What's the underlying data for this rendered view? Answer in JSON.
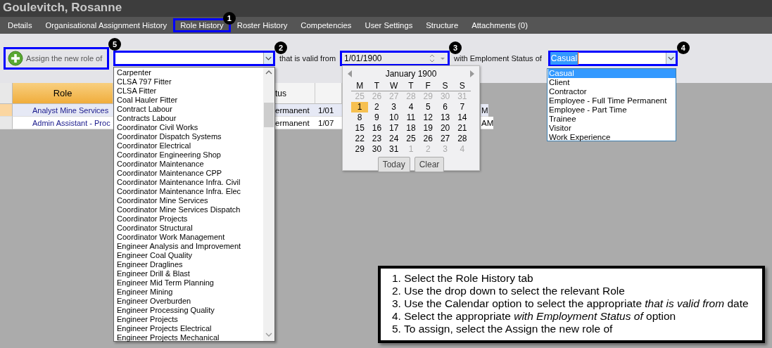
{
  "window": {
    "title": "Goulevitch, Rosanne"
  },
  "tabs": [
    {
      "label": "Details",
      "selected": false
    },
    {
      "label": "Organisational Assignment History",
      "selected": false
    },
    {
      "label": "Role History",
      "selected": true,
      "badge": "1"
    },
    {
      "label": "Roster History",
      "selected": false
    },
    {
      "label": "Competencies",
      "selected": false
    },
    {
      "label": "User Settings",
      "selected": false
    },
    {
      "label": "Structure",
      "selected": false
    },
    {
      "label": "Attachments (0)",
      "selected": false
    }
  ],
  "toolbar": {
    "assign_button": {
      "label": "Assign the new role of",
      "badge": "5"
    },
    "role_field": {
      "badge": "2"
    },
    "valid_from_label": "that is valid from",
    "date_field": {
      "value": "1/01/1900",
      "badge": "3"
    },
    "status_label": "with Emploment Status of",
    "status_field": {
      "value": "Casual",
      "badge": "4"
    }
  },
  "grid": {
    "columns": [
      "Role",
      "tus"
    ],
    "rows": [
      {
        "role": "Analyst Mine Services",
        "status": "ermanent",
        "date": "1/01",
        "time": "M",
        "selected": true
      },
      {
        "role": "Admin Assistant - Proc",
        "status": "ermanent",
        "date": "1/07",
        "time": "AM",
        "selected": false
      }
    ]
  },
  "role_dropdown": {
    "items": [
      "Carpenter",
      "CLSA 797 Fitter",
      "CLSA Fitter",
      "Coal Hauler Fitter",
      "Contract Labour",
      "Contracts Labour",
      "Coordinator Civil Works",
      "Coordinator Dispatch Systems",
      "Coordinator Electrical",
      "Coordinator Engineering Shop",
      "Coordinator Maintenance",
      "Coordinator Maintenance CPP",
      "Coordinator Maintenance Infra. Civil",
      "Coordinator Maintenance Infra. Elec",
      "Coordinator Mine Services",
      "Coordinator Mine Services Dispatch",
      "Coordinator Projects",
      "Coordinator Structural",
      "Coordinator Work Management",
      "Engineer Analysis and Improvement",
      "Engineer Coal Quality",
      "Engineer Draglines",
      "Engineer Drill & Blast",
      "Engineer Mid Term Planning",
      "Engineer Mining",
      "Engineer Overburden",
      "Engineer Processing Quality",
      "Engineer Projects",
      "Engineer Projects Electrical",
      "Engineer Projects Mechanical"
    ]
  },
  "calendar": {
    "title": "January 1900",
    "weekdays": [
      "M",
      "T",
      "W",
      "T",
      "F",
      "S",
      "S"
    ],
    "days": [
      {
        "label": "25",
        "muted": true,
        "selected": false
      },
      {
        "label": "26",
        "muted": true,
        "selected": false
      },
      {
        "label": "27",
        "muted": true,
        "selected": false
      },
      {
        "label": "28",
        "muted": true,
        "selected": false
      },
      {
        "label": "29",
        "muted": true,
        "selected": false
      },
      {
        "label": "30",
        "muted": true,
        "selected": false
      },
      {
        "label": "31",
        "muted": true,
        "selected": false
      },
      {
        "label": "1",
        "muted": false,
        "selected": true
      },
      {
        "label": "2",
        "muted": false,
        "selected": false
      },
      {
        "label": "3",
        "muted": false,
        "selected": false
      },
      {
        "label": "4",
        "muted": false,
        "selected": false
      },
      {
        "label": "5",
        "muted": false,
        "selected": false
      },
      {
        "label": "6",
        "muted": false,
        "selected": false
      },
      {
        "label": "7",
        "muted": false,
        "selected": false
      },
      {
        "label": "8",
        "muted": false,
        "selected": false
      },
      {
        "label": "9",
        "muted": false,
        "selected": false
      },
      {
        "label": "10",
        "muted": false,
        "selected": false
      },
      {
        "label": "11",
        "muted": false,
        "selected": false
      },
      {
        "label": "12",
        "muted": false,
        "selected": false
      },
      {
        "label": "13",
        "muted": false,
        "selected": false
      },
      {
        "label": "14",
        "muted": false,
        "selected": false
      },
      {
        "label": "15",
        "muted": false,
        "selected": false
      },
      {
        "label": "16",
        "muted": false,
        "selected": false
      },
      {
        "label": "17",
        "muted": false,
        "selected": false
      },
      {
        "label": "18",
        "muted": false,
        "selected": false
      },
      {
        "label": "19",
        "muted": false,
        "selected": false
      },
      {
        "label": "20",
        "muted": false,
        "selected": false
      },
      {
        "label": "21",
        "muted": false,
        "selected": false
      },
      {
        "label": "22",
        "muted": false,
        "selected": false
      },
      {
        "label": "23",
        "muted": false,
        "selected": false
      },
      {
        "label": "24",
        "muted": false,
        "selected": false
      },
      {
        "label": "25",
        "muted": false,
        "selected": false
      },
      {
        "label": "26",
        "muted": false,
        "selected": false
      },
      {
        "label": "27",
        "muted": false,
        "selected": false
      },
      {
        "label": "28",
        "muted": false,
        "selected": false
      },
      {
        "label": "29",
        "muted": false,
        "selected": false
      },
      {
        "label": "30",
        "muted": false,
        "selected": false
      },
      {
        "label": "31",
        "muted": false,
        "selected": false
      },
      {
        "label": "1",
        "muted": true,
        "selected": false
      },
      {
        "label": "2",
        "muted": true,
        "selected": false
      },
      {
        "label": "3",
        "muted": true,
        "selected": false
      },
      {
        "label": "4",
        "muted": true,
        "selected": false
      }
    ],
    "buttons": [
      "Today",
      "Clear"
    ]
  },
  "status_dropdown": {
    "items": [
      {
        "label": "Casual",
        "selected": true
      },
      {
        "label": "Client",
        "selected": false
      },
      {
        "label": "Contractor",
        "selected": false
      },
      {
        "label": "Employee - Full Time Permanent",
        "selected": false
      },
      {
        "label": "Employee - Part Time",
        "selected": false
      },
      {
        "label": "Trainee",
        "selected": false
      },
      {
        "label": "Visitor",
        "selected": false
      },
      {
        "label": "Work Experience",
        "selected": false
      }
    ]
  },
  "instructions": [
    "1. Select the Role History tab",
    "2. Use the drop down to select the relevant Role",
    "3. Use the Calendar option to select the appropriate *that is valid from* date",
    "4. Select the appropriate *with Employment Status of* option",
    "5. To assign, select the Assign the new role of"
  ]
}
